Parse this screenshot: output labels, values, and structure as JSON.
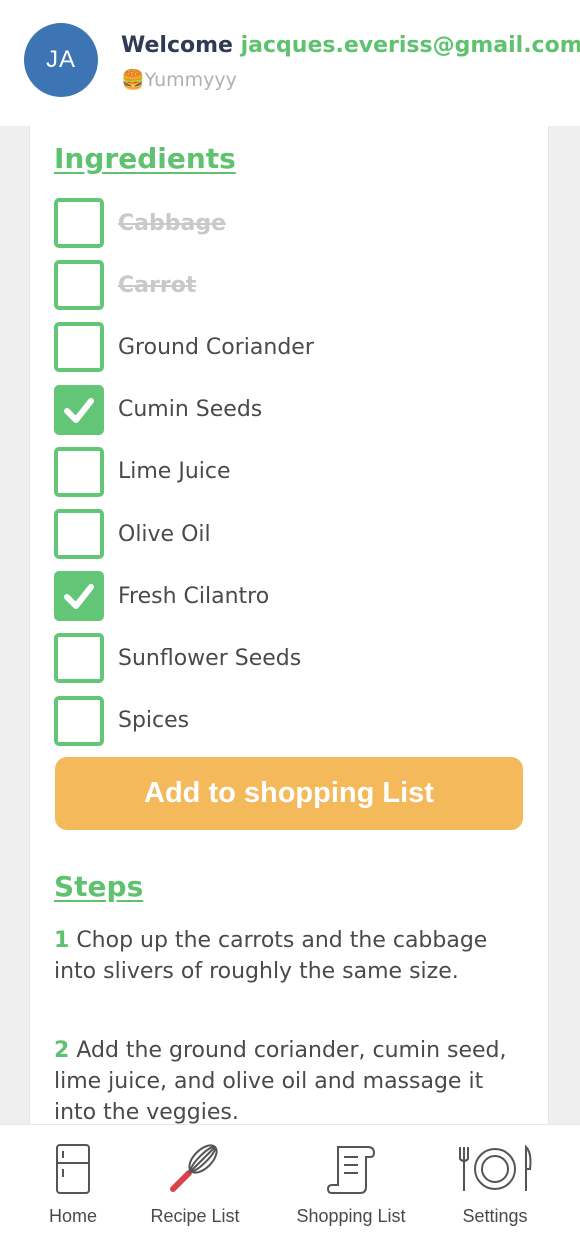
{
  "header": {
    "avatar_initials": "JA",
    "welcome": "Welcome",
    "email": "jacques.everiss@gmail.com",
    "subtitle_emoji": "🍔",
    "subtitle": "Yummyyy"
  },
  "ingredients": {
    "title": "Ingredients",
    "items": [
      {
        "label": "Cabbage",
        "checked": false,
        "struck": true
      },
      {
        "label": "Carrot",
        "checked": false,
        "struck": true
      },
      {
        "label": "Ground Coriander",
        "checked": false,
        "struck": false
      },
      {
        "label": "Cumin Seeds",
        "checked": true,
        "struck": false
      },
      {
        "label": "Lime Juice",
        "checked": false,
        "struck": false
      },
      {
        "label": "Olive Oil",
        "checked": false,
        "struck": false
      },
      {
        "label": "Fresh Cilantro",
        "checked": true,
        "struck": false
      },
      {
        "label": "Sunflower Seeds",
        "checked": false,
        "struck": false
      },
      {
        "label": "Spices",
        "checked": false,
        "struck": false
      }
    ],
    "add_button_label": "Add to shopping List"
  },
  "steps": {
    "title": "Steps",
    "items": [
      {
        "number": "1",
        "text": "Chop up the carrots and the cabbage into slivers of roughly the same size."
      },
      {
        "number": "2",
        "text": "Add the ground coriander, cumin seed, lime juice, and olive oil and massage it into the veggies."
      }
    ]
  },
  "tabbar": {
    "home": "Home",
    "recipe_list": "Recipe List",
    "shopping_list": "Shopping List",
    "settings": "Settings"
  },
  "colors": {
    "accent_green": "#5ec26f",
    "button_orange": "#f4b95b",
    "avatar_blue": "#3d75b4"
  }
}
